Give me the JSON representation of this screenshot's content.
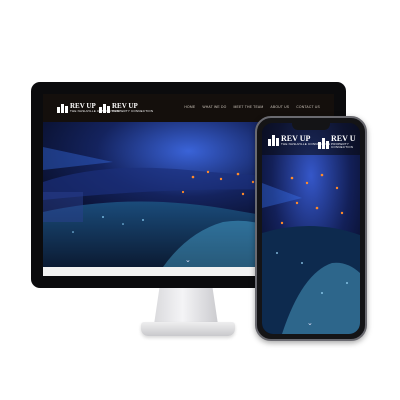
{
  "desktop": {
    "logo_left": {
      "title": "REV UP",
      "subtitle": "THE NASHVILLE CONNECTION"
    },
    "logo_right": {
      "title": "REV UP",
      "subtitle": "PROPERTY CONNECTION"
    },
    "nav": [
      "HOME",
      "WHAT WE DO",
      "MEET THE TEAM",
      "ABOUT US",
      "CONTACT US"
    ]
  },
  "mobile": {
    "logo_left": {
      "title": "REV UP",
      "subtitle": "THE NASHVILLE CONNECTION"
    },
    "logo_right": {
      "title": "REV U",
      "subtitle": "PROPERTY CONNECTION"
    }
  },
  "icons": {
    "scroll": "chevron-down-icon"
  },
  "colors": {
    "header": "#140f0c",
    "hero_base": "#05081a",
    "accent_blue": "#2b5cff",
    "accent_orange": "#ff8a2a"
  }
}
